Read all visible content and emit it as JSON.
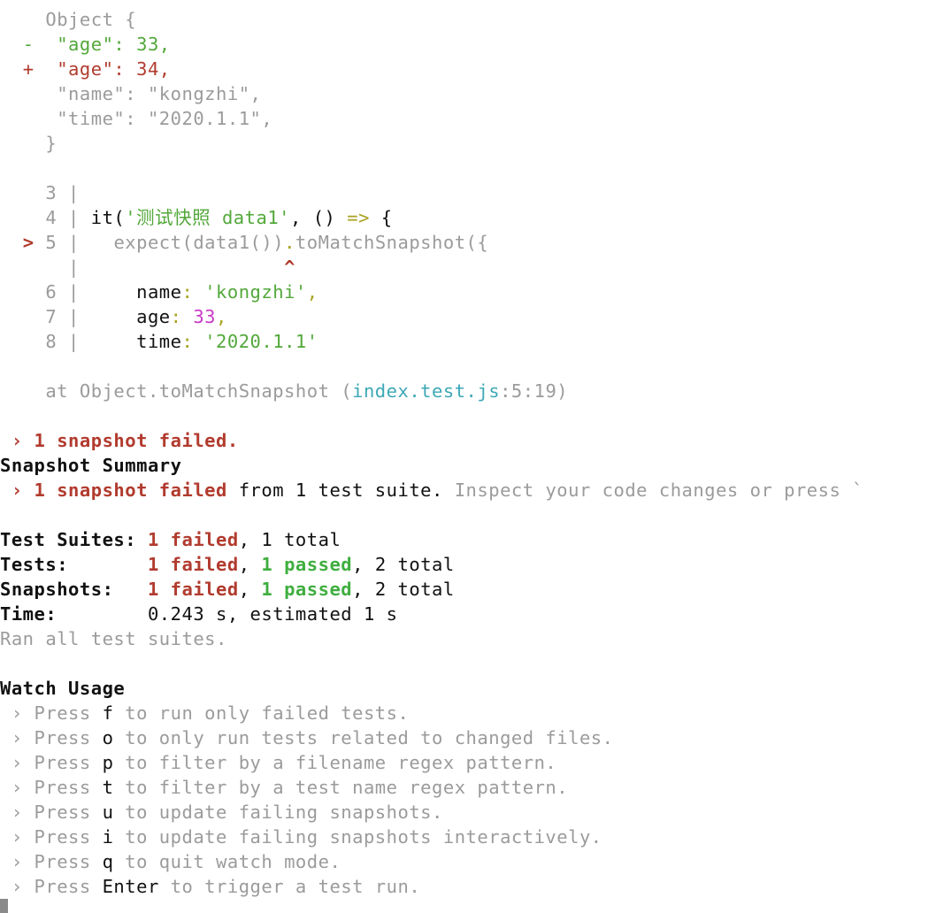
{
  "diff": {
    "object_open": "Object {",
    "minus_sign": "-",
    "minus_line": "\"age\": 33,",
    "plus_sign": "+",
    "plus_line": "\"age\": 34,",
    "name_line": "\"name\": \"kongzhi\",",
    "time_line": "\"time\": \"2020.1.1\",",
    "object_close": "}"
  },
  "code_frame": {
    "l3": "3 |",
    "l4_num": "4 |",
    "l4_it": "it(",
    "l4_str": "'测试快照 data1'",
    "l4_mid": ", () ",
    "l4_arrow": "=>",
    "l4_end": " {",
    "l5_marker": ">",
    "l5_num": "5",
    "l5_pipe": "|",
    "l5_pre": "expect(data1())",
    "l5_dot": ".",
    "l5_post": "toMatchSnapshot({",
    "caret_pipe": "|",
    "caret": "^",
    "l6_num": "6 |",
    "l6_key": "name",
    "l6_colon": ":",
    "l6_val": "'kongzhi'",
    "l6_comma": ",",
    "l7_num": "7 |",
    "l7_key": "age",
    "l7_colon": ":",
    "l7_val": "33",
    "l7_comma": ",",
    "l8_num": "8 |",
    "l8_key": "time",
    "l8_colon": ":",
    "l8_val": "'2020.1.1'"
  },
  "stack": {
    "prefix": "at Object.toMatchSnapshot (",
    "file": "index.test.js",
    "suffix": ":5:19)"
  },
  "snapshot_failed": {
    "arrow": "›",
    "text": "1 snapshot failed."
  },
  "snapshot_summary": {
    "title": "Snapshot Summary",
    "arrow": "›",
    "failed": "1 snapshot failed",
    "middle": " from 1 test suite.",
    "hint": "Inspect your code changes or press `"
  },
  "summary": {
    "suites_label": "Test Suites:",
    "suites_failed": "1 failed",
    "suites_total": ", 1 total",
    "tests_label": "Tests:",
    "tests_failed": "1 failed",
    "tests_passed": "1 passed",
    "tests_total": ", 2 total",
    "snapshots_label": "Snapshots:",
    "snapshots_failed": "1 failed",
    "snapshots_passed": "1 passed",
    "snapshots_total": ", 2 total",
    "time_label": "Time:",
    "time_value": "0.243 s, estimated 1 s",
    "ran": "Ran all test suites."
  },
  "watch_usage": {
    "title": "Watch Usage",
    "items": [
      {
        "arrow": "›",
        "press": "Press",
        "key": "f",
        "desc": "to run only failed tests."
      },
      {
        "arrow": "›",
        "press": "Press",
        "key": "o",
        "desc": "to only run tests related to changed files."
      },
      {
        "arrow": "›",
        "press": "Press",
        "key": "p",
        "desc": "to filter by a filename regex pattern."
      },
      {
        "arrow": "›",
        "press": "Press",
        "key": "t",
        "desc": "to filter by a test name regex pattern."
      },
      {
        "arrow": "›",
        "press": "Press",
        "key": "u",
        "desc": "to update failing snapshots."
      },
      {
        "arrow": "›",
        "press": "Press",
        "key": "i",
        "desc": "to update failing snapshots interactively."
      },
      {
        "arrow": "›",
        "press": "Press",
        "key": "q",
        "desc": "to quit watch mode."
      },
      {
        "arrow": "›",
        "press": "Press",
        "key": "Enter",
        "desc": "to trigger a test run."
      }
    ]
  }
}
